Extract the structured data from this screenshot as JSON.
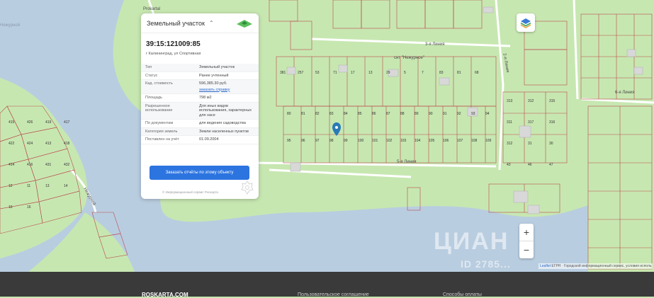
{
  "map": {
    "labels": {
      "lake_top_left": "Нежурной",
      "snt_name": "снт \"Нежурное\"",
      "street_3": "3-я Линия",
      "street_5": "5-я Линия",
      "street_6": "6-я Линия",
      "street_2": "2-я Линия",
      "street_top": "Prokartal",
      "street_lower_left": "Нежурной",
      "street_right": "Нежурной"
    },
    "parcels": [
      "80",
      "81",
      "82",
      "83",
      "84",
      "85",
      "86",
      "87",
      "88",
      "89",
      "90",
      "91",
      "92",
      "93",
      "94",
      "95",
      "96",
      "97",
      "98",
      "99",
      "100",
      "101",
      "102",
      "103",
      "104",
      "105",
      "106",
      "107",
      "108",
      "109",
      "110",
      "111",
      "112",
      "113",
      "114",
      "115",
      "116",
      "117",
      "118",
      "119",
      "120",
      "121",
      "122",
      "123",
      "124",
      "125",
      "126",
      "127",
      "128",
      "129",
      "130",
      "131",
      "132"
    ],
    "left_parcels": [
      "415",
      "426",
      "419",
      "417",
      "422",
      "424",
      "413",
      "418",
      "414",
      "416",
      "431",
      "432",
      "12",
      "11",
      "13",
      "14",
      "15",
      "16"
    ],
    "right_parcels": [
      "313",
      "312",
      "315",
      "311",
      "317",
      "316",
      "312",
      "31",
      "30",
      "43",
      "46",
      "47",
      "48",
      "49",
      "50",
      "51",
      "52",
      "53",
      "54",
      "55",
      "56",
      "57"
    ],
    "other_parcels": [
      "381",
      "257",
      "53",
      "71",
      "17",
      "13",
      "29",
      "5",
      "7",
      "83",
      "81",
      "68",
      "67",
      "76",
      "79",
      "89",
      "94",
      "97",
      "98",
      "99",
      "92",
      "37"
    ]
  },
  "card": {
    "title": "Земельный участок",
    "cadastral_number": "39:15:121009:85",
    "address": "г Калининград, ул Спортивная",
    "rows": [
      {
        "key": "Тип",
        "value": "Земельный участок"
      },
      {
        "key": "Статус",
        "value": "Ранее учтенный"
      },
      {
        "key": "Кад. стоимость",
        "value": "596,385.30 руб.",
        "link": "заказать справку"
      },
      {
        "key": "Площадь",
        "value": "798 м2"
      },
      {
        "key": "Разрешенное использование",
        "value": "Для иных видов использования, характерных для насе"
      },
      {
        "key": "По документам",
        "value": "для ведения садоводства"
      },
      {
        "key": "Категория земель",
        "value": "Земли населенных пунктов"
      },
      {
        "key": "Поставлен на учёт",
        "value": "01.09.2004"
      }
    ],
    "cta_label": "Заказать отчёты по этому объекту",
    "footer_note": "© Информационный сервис Роскарта"
  },
  "controls": {
    "zoom_in": "+",
    "zoom_out": "−"
  },
  "attribution": {
    "prefix": "Leaflet",
    "text": " ЕГРН · Городской информационный сервис, условия исполь"
  },
  "watermark": {
    "logo": "ЦИАН",
    "id": "ID 2785..."
  },
  "footer": {
    "brand": "ROSKARTA.COM",
    "link1": "Пользовательское соглашение",
    "link2": "Способы оплаты"
  },
  "colors": {
    "land": "#c7e7b1",
    "water": "#b9cde0",
    "cta": "#2c74e0",
    "parcel_line": "#b94b4b",
    "marker": "#2a7ab8"
  }
}
